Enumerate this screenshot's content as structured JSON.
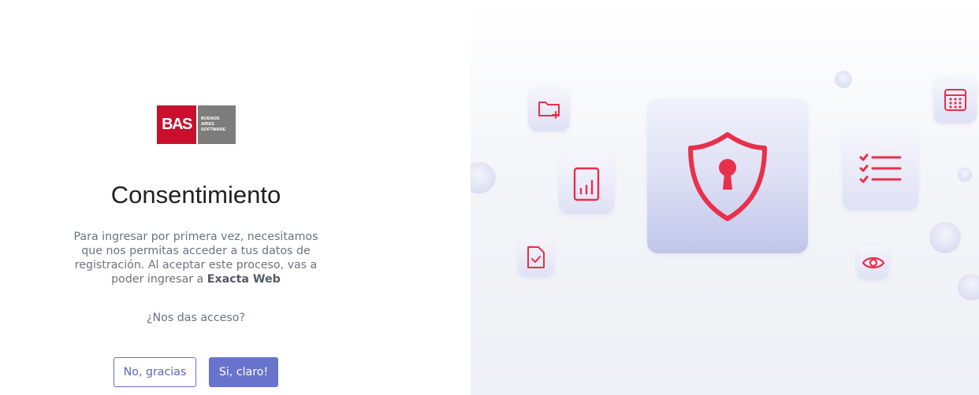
{
  "logo": {
    "mark": "BAS",
    "words": [
      "BUENOS",
      "AIRES",
      "SOFTWARE"
    ]
  },
  "consent": {
    "title": "Consentimiento",
    "description_prefix": "Para ingresar por primera vez, necesitamos que nos permitas acceder a tus datos de registración. Al aceptar este proceso, vas a poder ingresar a ",
    "app_name": "Exacta Web",
    "question": "¿Nos das acceso?"
  },
  "buttons": {
    "decline_label": "No, gracias",
    "accept_label": "Si, claro!"
  },
  "colors": {
    "brand_red": "#c8102e",
    "accent": "#6873cc",
    "icon_red": "#e8304a"
  },
  "illustration": {
    "icons": [
      "folder-plus-icon",
      "bar-chart-icon",
      "shield-lock-icon",
      "checklist-icon",
      "calendar-icon",
      "document-check-icon",
      "eye-icon"
    ]
  }
}
